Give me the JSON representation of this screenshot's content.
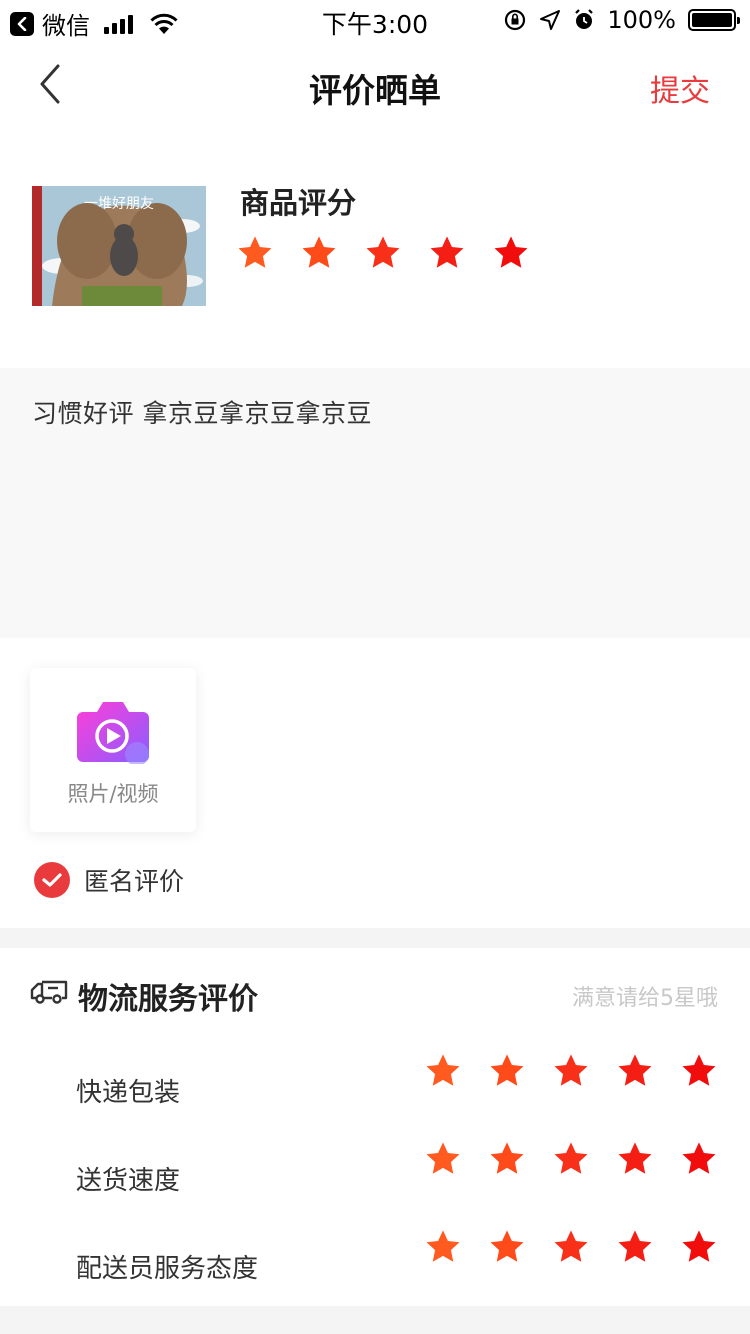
{
  "status_bar": {
    "back_app": "微信",
    "time": "下午3:00",
    "battery": "100%"
  },
  "nav": {
    "title": "评价晒单",
    "submit": "提交",
    "back_icon": "chevron-left-icon"
  },
  "product": {
    "score_label": "商品评分",
    "rating": 5,
    "max_rating": 5,
    "image_title": "一堆好朋友"
  },
  "review": {
    "text": "习惯好评 拿京豆拿京豆拿京豆"
  },
  "upload": {
    "label": "照片/视频",
    "icon": "camera-video-icon"
  },
  "anonymous": {
    "label": "匿名评价",
    "checked": true
  },
  "logistics": {
    "title": "物流服务评价",
    "hint": "满意请给5星哦",
    "icon": "truck-icon",
    "rows": [
      {
        "label": "快递包装",
        "rating": 5
      },
      {
        "label": "送货速度",
        "rating": 5
      },
      {
        "label": "配送员服务态度",
        "rating": 5
      }
    ]
  },
  "colors": {
    "accent": "#e93b3d",
    "star_gradient": [
      "#ff5a1f",
      "#ff4a1a",
      "#f8301a",
      "#f51e14",
      "#f20d0d"
    ]
  }
}
